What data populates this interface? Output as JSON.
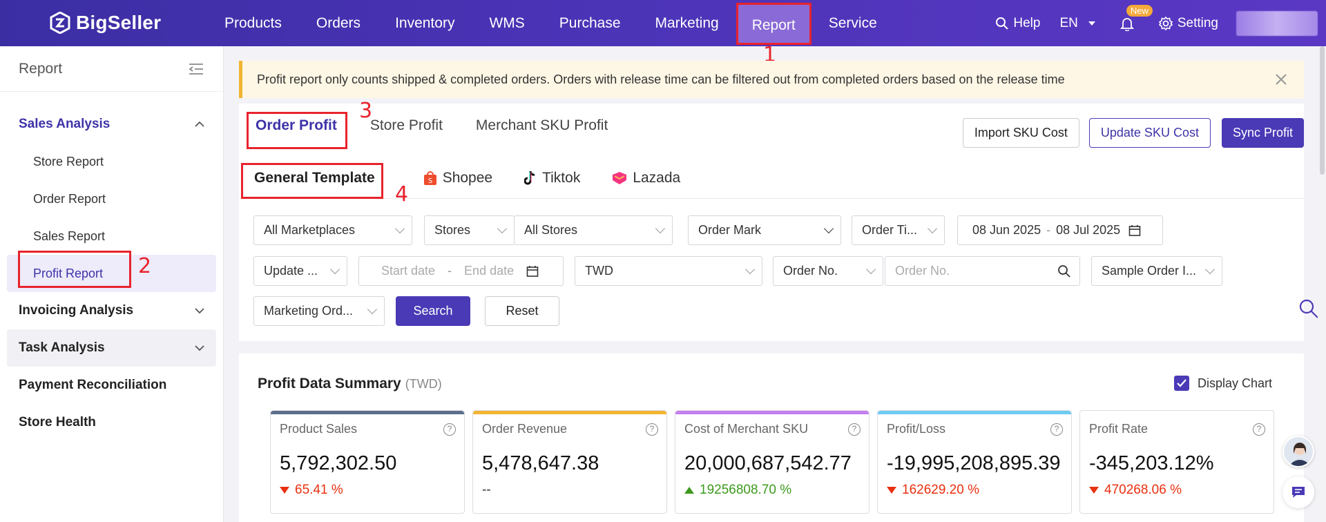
{
  "brand": "BigSeller",
  "nav": {
    "items": [
      "Products",
      "Orders",
      "Inventory",
      "WMS",
      "Purchase",
      "Marketing",
      "Report",
      "Service"
    ],
    "active": "Report",
    "help": "Help",
    "lang": "EN",
    "new_badge": "New",
    "setting": "Setting"
  },
  "annotations": [
    "1",
    "2",
    "3",
    "4"
  ],
  "sidebar": {
    "title": "Report",
    "groups": [
      {
        "label": "Sales Analysis",
        "items": [
          "Store Report",
          "Order Report",
          "Sales Report",
          "Profit Report"
        ]
      },
      {
        "label": "Invoicing Analysis"
      },
      {
        "label": "Task Analysis"
      },
      {
        "label": "Payment Reconciliation"
      },
      {
        "label": "Store Health"
      }
    ],
    "active_item": "Profit Report"
  },
  "notice": "Profit report only counts shipped & completed orders. Orders with release time can be filtered out from completed orders based on the release time",
  "tabs": [
    "Order Profit",
    "Store Profit",
    "Merchant SKU Profit"
  ],
  "buttons": {
    "import": "Import SKU Cost",
    "update": "Update SKU Cost",
    "sync": "Sync Profit"
  },
  "templates": [
    "General Template",
    "Shopee",
    "Tiktok",
    "Lazada"
  ],
  "filters": {
    "marketplaces": "All Marketplaces",
    "stores_label": "Stores",
    "stores": "All Stores",
    "order_mark": "Order Mark",
    "order_time": "Order Ti...",
    "date_from": "08 Jun 2025",
    "date_to": "08 Jul 2025",
    "update": "Update ...",
    "start_ph": "Start date",
    "end_ph": "End date",
    "currency": "TWD",
    "order_no_label": "Order No.",
    "order_no_ph": "Order No.",
    "sample": "Sample Order I...",
    "marketing": "Marketing Ord...",
    "search": "Search",
    "reset": "Reset",
    "dash": "-"
  },
  "summary": {
    "title": "Profit Data Summary",
    "currency": "(TWD)",
    "display_chart": "Display Chart",
    "cards": [
      {
        "label": "Product Sales",
        "value": "5,792,302.50",
        "change": "65.41 %",
        "dir": "down",
        "color": "#5b6e8c"
      },
      {
        "label": "Order Revenue",
        "value": "5,478,647.38",
        "change": "--",
        "dir": "none",
        "color": "#f2b431"
      },
      {
        "label": "Cost of Merchant SKU",
        "value": "20,000,687,542.77",
        "change": "19256808.70 %",
        "dir": "up",
        "color": "#c47ff0"
      },
      {
        "label": "Profit/Loss",
        "value": "-19,995,208,895.39",
        "change": "162629.20 %",
        "dir": "down",
        "color": "#6ecbf2"
      },
      {
        "label": "Profit Rate",
        "value": "-345,203.12%",
        "change": "470268.06 %",
        "dir": "down",
        "color": "#ffffff"
      }
    ]
  }
}
